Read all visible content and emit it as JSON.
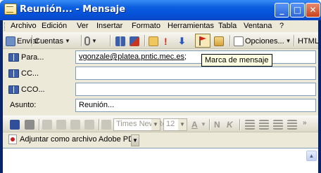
{
  "window": {
    "title": "Reunión... - Mensaje",
    "min": "_",
    "max": "□",
    "close": "✕"
  },
  "menu": [
    "Archivo",
    "Edición",
    "Ver",
    "Insertar",
    "Formato",
    "Herramientas",
    "Tabla",
    "Ventana",
    "?"
  ],
  "toolbar": {
    "send": "Enviar",
    "accounts": "Cuentas",
    "options": "Opciones...",
    "format": "HTML"
  },
  "tooltip": "Marca de mensaje",
  "fields": {
    "to_label": "Para...",
    "to_value": "vgonzale@platea.pntic.mec.es",
    "to_suffix": ";",
    "cc_label": "CC...",
    "cc_value": "",
    "bcc_label": "CCO...",
    "bcc_value": "",
    "subject_label": "Asunto:",
    "subject_value": "Reunión..."
  },
  "format_bar": {
    "font": "Times New Roman",
    "size": "12",
    "bold": "N",
    "italic": "K"
  },
  "attach": {
    "label": "Adjuntar como archivo Adobe PDF"
  }
}
